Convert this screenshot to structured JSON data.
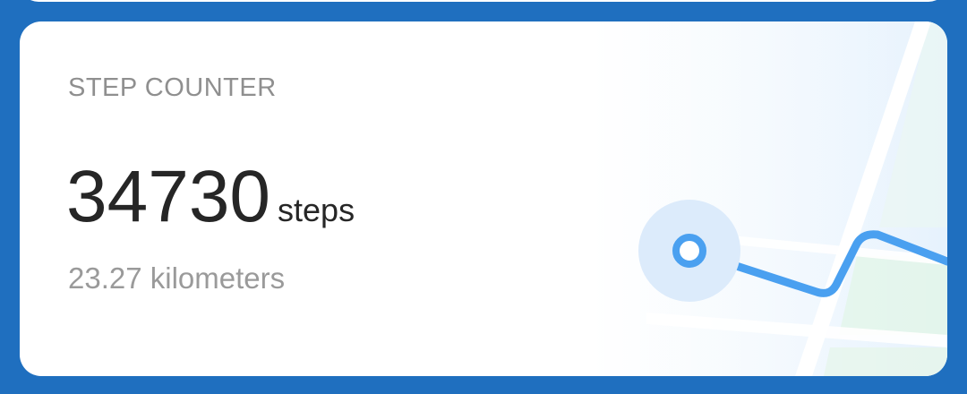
{
  "card": {
    "title": "STEP COUNTER",
    "steps_value": "34730",
    "steps_unit": "steps",
    "distance": "23.27 kilometers"
  },
  "colors": {
    "page_background": "#1f6fbf",
    "card_background": "#ffffff",
    "title_text": "#8f8f8f",
    "primary_text": "#262626",
    "secondary_text": "#9a9a9a",
    "route_line": "#4aa0f0",
    "map_green": "#e3f5ec",
    "location_halo": "#dcebfb"
  },
  "icons": {
    "route": "route-line-icon",
    "location": "location-marker-icon",
    "map": "map-background-icon"
  }
}
